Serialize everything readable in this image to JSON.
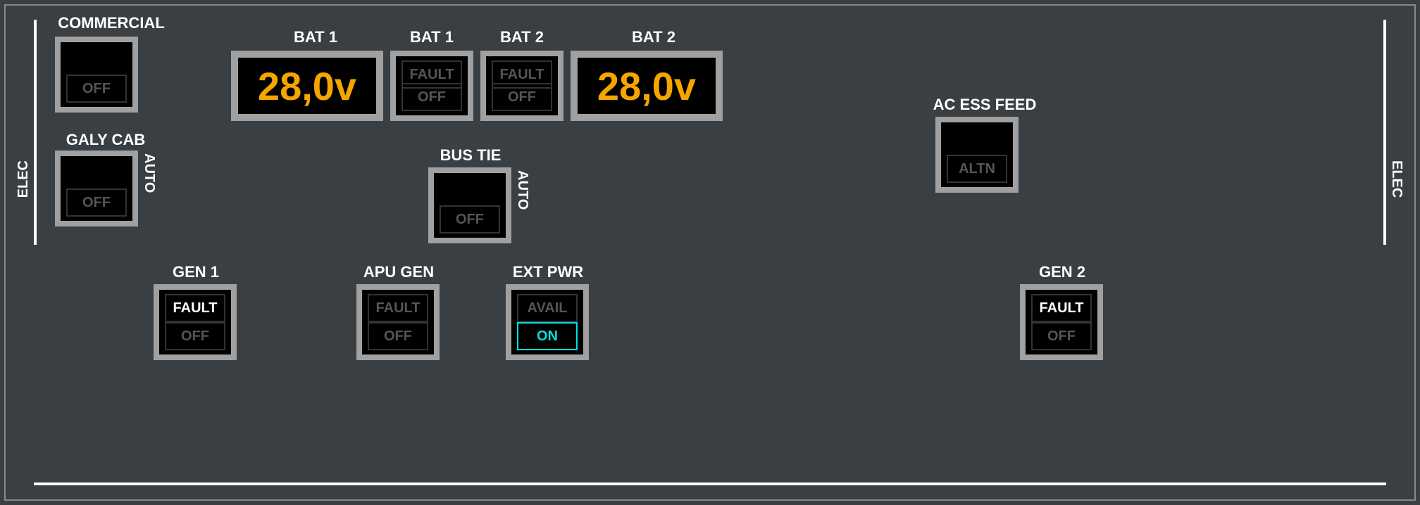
{
  "sideLabel": "ELEC",
  "labels": {
    "commercial": "COMMERCIAL",
    "bat1_disp": "BAT 1",
    "bat1_btn": "BAT 1",
    "bat2_btn": "BAT 2",
    "bat2_disp": "BAT 2",
    "galycab": "GALY CAB",
    "bustie": "BUS TIE",
    "acessfeed": "AC ESS FEED",
    "gen1": "GEN 1",
    "apugen": "APU GEN",
    "extpwr": "EXT PWR",
    "gen2": "GEN 2"
  },
  "autoText": "AUTO",
  "displays": {
    "bat1_voltage": "28,0v",
    "bat2_voltage": "28,0v"
  },
  "annunciators": {
    "off": "OFF",
    "fault": "FAULT",
    "avail": "AVAIL",
    "on": "ON",
    "altn": "ALTN"
  },
  "states": {
    "gen1_fault_lit": true,
    "gen2_fault_lit": true,
    "extpwr_on_lit": true
  }
}
